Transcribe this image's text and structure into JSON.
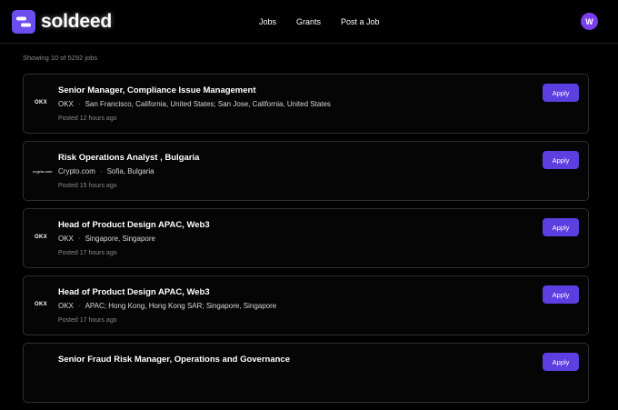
{
  "nav": {
    "brand": "soldeed",
    "links": [
      "Jobs",
      "Grants",
      "Post a Job"
    ],
    "avatar_initial": "W"
  },
  "results": {
    "count_text": "Showing 10 of 5292 jobs"
  },
  "jobs": [
    {
      "company_logo": "OKX",
      "title": "Senior Manager, Compliance Issue Management",
      "company": "OKX",
      "location": "San Francisco, California, United States; San Jose, California, United States",
      "posted": "Posted 12 hours ago",
      "apply_label": "Apply"
    },
    {
      "company_logo": "crypto.com",
      "title": "Risk Operations Analyst , Bulgaria",
      "company": "Crypto.com",
      "location": "Sofia, Bulgaria",
      "posted": "Posted 15 hours ago",
      "apply_label": "Apply"
    },
    {
      "company_logo": "OKX",
      "title": "Head of Product Design APAC, Web3",
      "company": "OKX",
      "location": "Singapore, Singapore",
      "posted": "Posted 17 hours ago",
      "apply_label": "Apply"
    },
    {
      "company_logo": "OKX",
      "title": "Head of Product Design APAC, Web3",
      "company": "OKX",
      "location": "APAC; Hong Kong, Hong Kong SAR; Singapore, Singapore",
      "posted": "Posted 17 hours ago",
      "apply_label": "Apply"
    },
    {
      "company_logo": "",
      "title": "Senior Fraud Risk Manager, Operations and Governance",
      "company": "",
      "location": "",
      "posted": "",
      "apply_label": "Apply"
    }
  ],
  "colors": {
    "accent": "#5b3fe0",
    "brand": "#6c4df0",
    "avatar": "#7b3ff0"
  },
  "icons": {
    "brand_logo": "soldeed-link-icon"
  }
}
